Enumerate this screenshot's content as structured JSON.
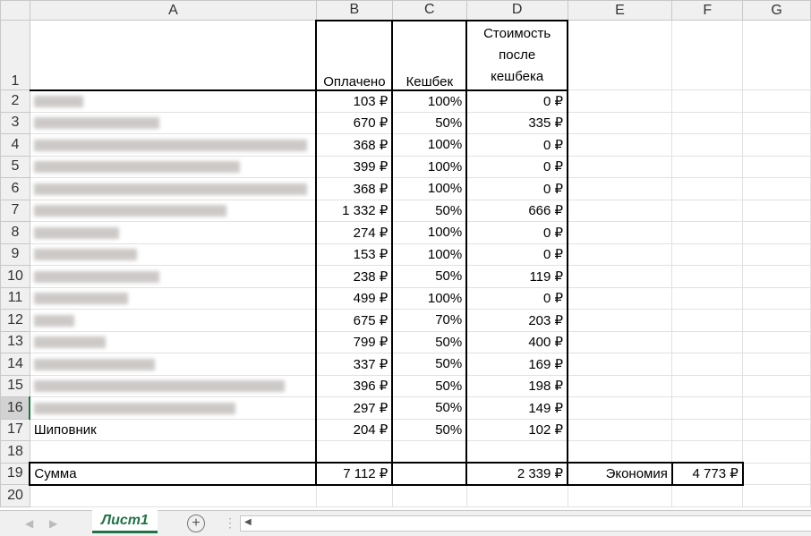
{
  "columns": [
    "A",
    "B",
    "C",
    "D",
    "E",
    "F",
    "G"
  ],
  "headers": {
    "paid": "Оплачено",
    "cashback": "Кешбек",
    "cost_after": "Стоимость после кешбека"
  },
  "rows": [
    {
      "n": "2",
      "name": "",
      "paid": "103 ₽",
      "cb": "100%",
      "cost": "0 ₽",
      "bw": 55
    },
    {
      "n": "3",
      "name": "",
      "paid": "670 ₽",
      "cb": "50%",
      "cost": "335 ₽",
      "bw": 140
    },
    {
      "n": "4",
      "name": "",
      "paid": "368 ₽",
      "cb": "100%",
      "cost": "0 ₽",
      "bw": 305
    },
    {
      "n": "5",
      "name": "",
      "paid": "399 ₽",
      "cb": "100%",
      "cost": "0 ₽",
      "bw": 230
    },
    {
      "n": "6",
      "name": "",
      "paid": "368 ₽",
      "cb": "100%",
      "cost": "0 ₽",
      "bw": 305
    },
    {
      "n": "7",
      "name": "",
      "paid": "1 332 ₽",
      "cb": "50%",
      "cost": "666 ₽",
      "bw": 215
    },
    {
      "n": "8",
      "name": "",
      "paid": "274 ₽",
      "cb": "100%",
      "cost": "0 ₽",
      "bw": 95
    },
    {
      "n": "9",
      "name": "",
      "paid": "153 ₽",
      "cb": "100%",
      "cost": "0 ₽",
      "bw": 115
    },
    {
      "n": "10",
      "name": "",
      "paid": "238 ₽",
      "cb": "50%",
      "cost": "119 ₽",
      "bw": 140
    },
    {
      "n": "11",
      "name": "",
      "paid": "499 ₽",
      "cb": "100%",
      "cost": "0 ₽",
      "bw": 105
    },
    {
      "n": "12",
      "name": "",
      "paid": "675 ₽",
      "cb": "70%",
      "cost": "203 ₽",
      "bw": 45
    },
    {
      "n": "13",
      "name": "",
      "paid": "799 ₽",
      "cb": "50%",
      "cost": "400 ₽",
      "bw": 80
    },
    {
      "n": "14",
      "name": "",
      "paid": "337 ₽",
      "cb": "50%",
      "cost": "169 ₽",
      "bw": 135
    },
    {
      "n": "15",
      "name": "",
      "paid": "396 ₽",
      "cb": "50%",
      "cost": "198 ₽",
      "bw": 280
    },
    {
      "n": "16",
      "name": "",
      "paid": "297 ₽",
      "cb": "50%",
      "cost": "149 ₽",
      "bw": 225
    },
    {
      "n": "17",
      "name": "Шиповник",
      "paid": "204 ₽",
      "cb": "50%",
      "cost": "102 ₽",
      "bw": 0
    }
  ],
  "total": {
    "label": "Сумма",
    "paid": "7 112 ₽",
    "cost": "2 339 ₽",
    "savings_label": "Экономия",
    "savings": "4 773 ₽"
  },
  "row_numbers": {
    "r1": "1",
    "r18": "18",
    "r19": "19",
    "r20": "20"
  },
  "sheet_tab": "Лист1",
  "add_sheet": "+"
}
